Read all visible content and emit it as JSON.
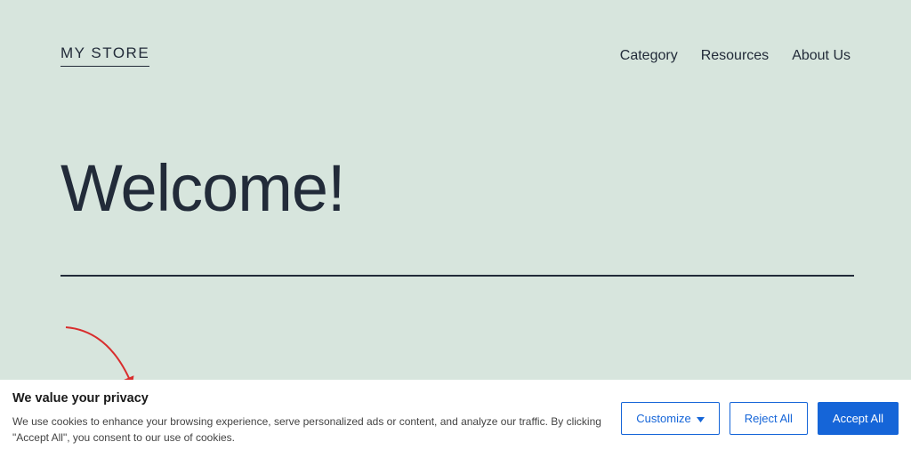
{
  "header": {
    "logo": "MY STORE",
    "nav": [
      "Category",
      "Resources",
      "About Us"
    ]
  },
  "hero": {
    "title": "Welcome!"
  },
  "cookie": {
    "title": "We value your privacy",
    "desc": "We use cookies to enhance your browsing experience, serve personalized ads or content, and analyze our traffic. By clicking \"Accept All\", you consent to our use of cookies.",
    "customize": "Customize",
    "reject": "Reject All",
    "accept": "Accept All"
  },
  "colors": {
    "page_bg": "#d7e5dd",
    "text": "#222b39",
    "accent": "#1565d8",
    "arrow": "#d82d2d"
  }
}
